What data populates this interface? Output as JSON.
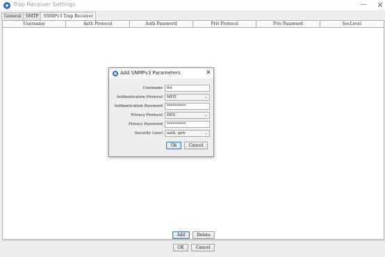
{
  "window": {
    "title": "Trap Receiver Settings",
    "minimize_glyph": "—",
    "close_glyph": "✕"
  },
  "tabs": [
    {
      "label": "General"
    },
    {
      "label": "SMTP"
    },
    {
      "label": "SNMPv3 Trap Receiver"
    }
  ],
  "table": {
    "columns": [
      "Username",
      "Auth Protocol",
      "Auth Password",
      "Priv Protocol",
      "Priv Password",
      "SecLevel"
    ]
  },
  "table_buttons": {
    "add": "Add",
    "delete": "Delete"
  },
  "footer_buttons": {
    "ok": "OK",
    "cancel": "Cancel"
  },
  "dialog": {
    "title": "Add SNMPv3 Parameters",
    "close_glyph": "✕",
    "fields": {
      "username": {
        "label": "Username",
        "value": "fre"
      },
      "auth_protocol": {
        "label": "Authentication Protocol",
        "value": "MD5"
      },
      "auth_password": {
        "label": "Authentication Password",
        "value": "**********"
      },
      "priv_protocol": {
        "label": "Privacy Protocol",
        "value": "DES"
      },
      "priv_password": {
        "label": "Privacy Password",
        "value": "**********"
      },
      "security_level": {
        "label": "Security Level",
        "value": "auth, priv"
      }
    },
    "ok": "Ok",
    "cancel": "Cancel"
  },
  "icons": {
    "chevron": "⌄",
    "accent": "#2b6cb8"
  }
}
